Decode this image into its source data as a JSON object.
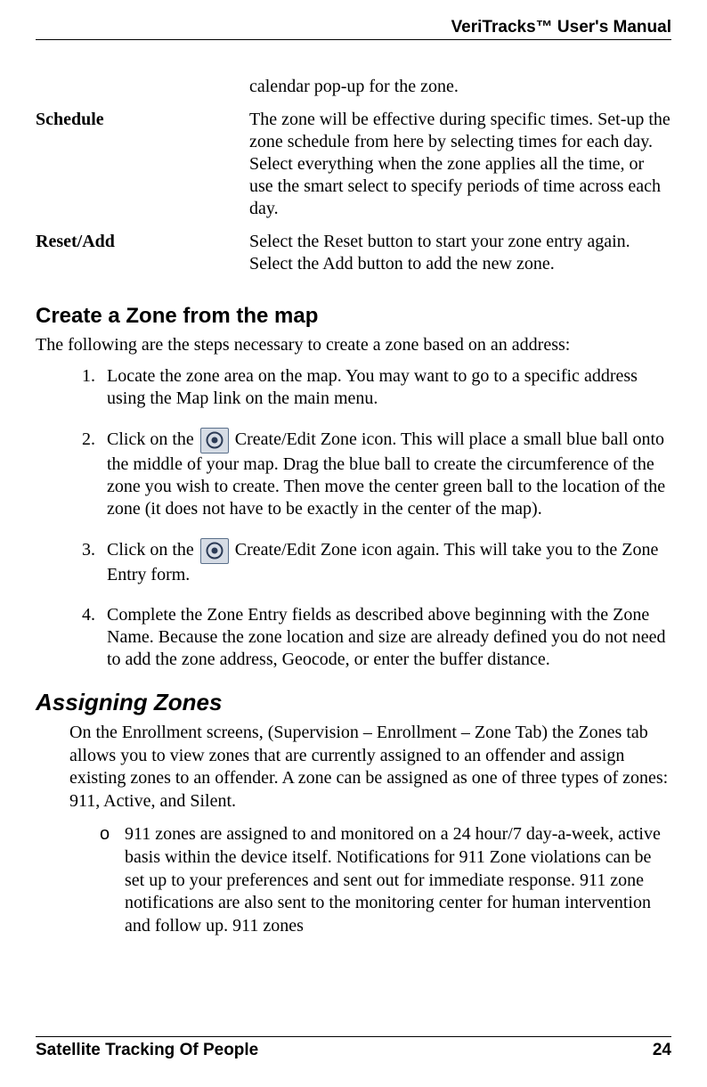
{
  "header": {
    "title": "VeriTracks™ User's Manual"
  },
  "defs": [
    {
      "label": "",
      "text": "calendar pop-up for the zone."
    },
    {
      "label": "Schedule",
      "text": "The zone will be effective during specific times.  Set-up the zone schedule from here by selecting times for each day. Select everything when the zone applies all the time, or use the smart select to specify periods of time across each day."
    },
    {
      "label": "Reset/Add",
      "text": "Select the Reset button to start your zone entry again.  Select the Add button to add the new zone."
    }
  ],
  "section1": {
    "heading": "Create a Zone from the map",
    "intro": "The following are the steps necessary to create a zone based on an address:",
    "steps": {
      "s1": "Locate the zone area on the map.  You may want to go to a specific address using the Map link on the main menu.",
      "s2_pre": "Click on the ",
      "s2_post": " Create/Edit Zone icon.  This will place a small blue ball onto the middle of your map.  Drag the blue ball to create the circumference of the zone you wish to create.  Then move the center green ball to the location of the zone (it does not have to be exactly in the center of the map).",
      "s3_pre": "Click on the ",
      "s3_post": " Create/Edit Zone icon again. This will take you to the Zone Entry form.",
      "s4": "Complete the Zone Entry fields as described above beginning with the Zone Name. Because the zone location and size are already defined you do not need to add the zone address, Geocode, or enter the buffer distance."
    }
  },
  "section2": {
    "heading": "Assigning Zones",
    "para": "On the Enrollment screens, (Supervision – Enrollment – Zone Tab) the Zones tab allows you to view zones that are currently assigned to an offender and assign existing zones to an offender.  A zone can be assigned as one of three types of zones:  911, Active, and Silent.",
    "bullet_marker": "o",
    "bullet_text": "911 zones are assigned to and monitored on a 24 hour/7 day-a-week, active basis within the device itself.  Notifications for 911 Zone violations can be set up to your preferences and sent out for immediate response.  911 zone notifications are also sent to the monitoring center for human intervention and follow up.  911 zones"
  },
  "footer": {
    "left": "Satellite Tracking Of People",
    "right": "24"
  },
  "icons": {
    "create_edit_zone": "create-edit-zone-icon"
  }
}
